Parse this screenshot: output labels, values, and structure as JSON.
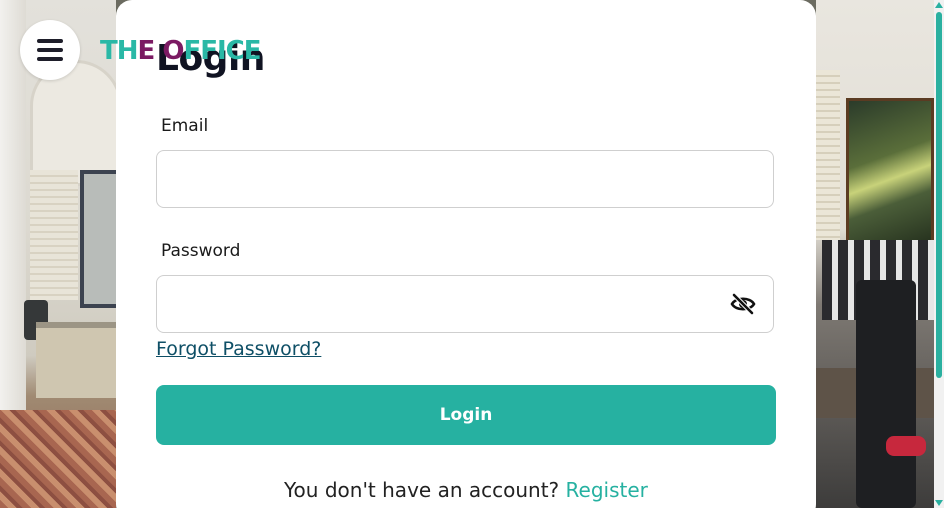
{
  "brand": {
    "logo_text_1": "TH",
    "logo_text_accent": "E",
    "logo_text_2": " ",
    "logo_text_3": "O",
    "logo_text_4": "FFICE",
    "primary_color": "#26b1a1",
    "accent_color": "#7b1a63"
  },
  "nav": {
    "menu_icon": "hamburger-menu-icon"
  },
  "login": {
    "title": "Login",
    "email_label": "Email",
    "email_value": "",
    "password_label": "Password",
    "password_value": "",
    "toggle_visibility_icon": "eye-slash-icon",
    "forgot_password": "Forgot Password?",
    "submit_label": "Login",
    "no_account_text": "You don't have an account? ",
    "register_link": "Register"
  }
}
